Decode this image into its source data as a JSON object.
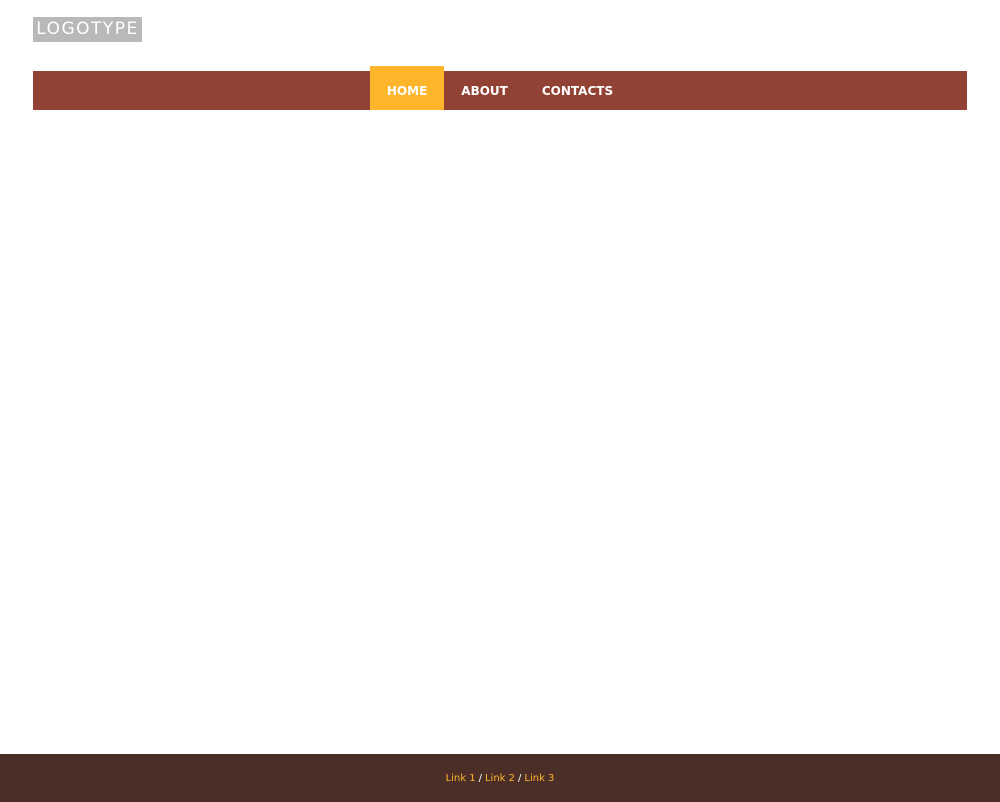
{
  "header": {
    "logo_text": "LOGOTYPE"
  },
  "nav": {
    "items": [
      {
        "label": "HOME",
        "active": true
      },
      {
        "label": "ABOUT",
        "active": false
      },
      {
        "label": "CONTACTS",
        "active": false
      }
    ]
  },
  "footer": {
    "links": [
      {
        "label": "Link 1"
      },
      {
        "label": "Link 2"
      },
      {
        "label": "Link 3"
      }
    ],
    "separator": "/"
  },
  "colors": {
    "nav_background": "#924234",
    "nav_active": "#fdb52b",
    "footer_background": "#4b2e27",
    "footer_link": "#fdb52b",
    "logo_background": "#b9b9b9"
  }
}
